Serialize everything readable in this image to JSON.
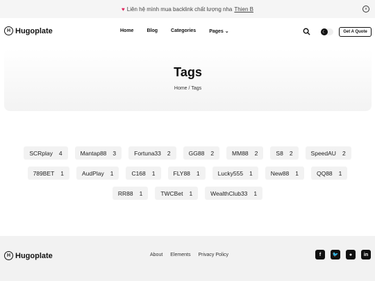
{
  "announcement": {
    "icon": "heart-icon",
    "text": "Liên hệ mình mua backlink chất lượng nha",
    "link": "Thien B"
  },
  "header": {
    "logo_text": "Hugoplate",
    "nav": [
      "Home",
      "Blog",
      "Categories",
      "Pages"
    ],
    "quote_button": "Get A Quote"
  },
  "hero": {
    "title": "Tags",
    "breadcrumb_home": "Home",
    "breadcrumb_sep": "/",
    "breadcrumb_current": "Tags"
  },
  "tags": [
    [
      {
        "name": "SCRplay",
        "count": "4"
      },
      {
        "name": "Mantap88",
        "count": "3"
      },
      {
        "name": "Fortuna33",
        "count": "2"
      },
      {
        "name": "GG88",
        "count": "2"
      },
      {
        "name": "MM88",
        "count": "2"
      },
      {
        "name": "S8",
        "count": "2"
      },
      {
        "name": "SpeedAU",
        "count": "2"
      }
    ],
    [
      {
        "name": "789BET",
        "count": "1"
      },
      {
        "name": "AudPlay",
        "count": "1"
      },
      {
        "name": "C168",
        "count": "1"
      },
      {
        "name": "FLY88",
        "count": "1"
      },
      {
        "name": "Lucky555",
        "count": "1"
      },
      {
        "name": "New88",
        "count": "1"
      },
      {
        "name": "QQ88",
        "count": "1"
      }
    ],
    [
      {
        "name": "RR88",
        "count": "1"
      },
      {
        "name": "TWCBet",
        "count": "1"
      },
      {
        "name": "WealthClub33",
        "count": "1"
      }
    ]
  ],
  "footer": {
    "logo_text": "Hugoplate",
    "links": [
      "About",
      "Elements",
      "Privacy Policy"
    ],
    "socials": [
      "facebook-icon",
      "twitter-icon",
      "github-icon",
      "linkedin-icon"
    ]
  }
}
